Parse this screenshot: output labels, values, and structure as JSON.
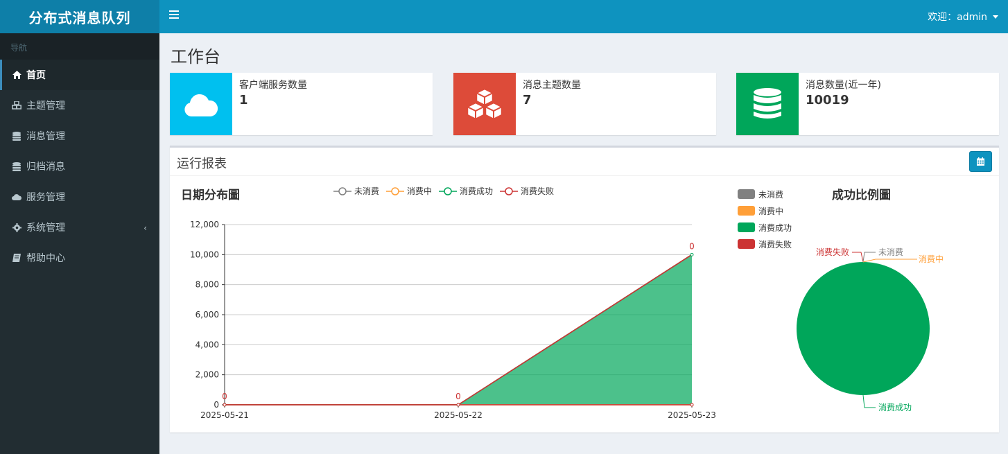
{
  "header": {
    "logo": "分布式消息队列",
    "welcome": "欢迎：admin"
  },
  "sidebar": {
    "header": "导航",
    "items": [
      {
        "label": "首页",
        "icon": "home-icon"
      },
      {
        "label": "主题管理",
        "icon": "cubes-icon"
      },
      {
        "label": "消息管理",
        "icon": "database-icon"
      },
      {
        "label": "归档消息",
        "icon": "database-icon"
      },
      {
        "label": "服务管理",
        "icon": "cloud-icon"
      },
      {
        "label": "系统管理",
        "icon": "gear-icon",
        "arrow": "‹"
      },
      {
        "label": "帮助中心",
        "icon": "book-icon"
      }
    ]
  },
  "page": {
    "title": "工作台"
  },
  "info_boxes": [
    {
      "label": "客户端服务数量",
      "value": "1",
      "color": "#00c0ef",
      "icon": "cloud-icon"
    },
    {
      "label": "消息主题数量",
      "value": "7",
      "color": "#dd4b39",
      "icon": "cubes-icon"
    },
    {
      "label": "消息数量(近一年)",
      "value": "10019",
      "color": "#00a65a",
      "icon": "database-icon"
    }
  ],
  "report": {
    "title": "运行报表",
    "tool_icon": "calendar-icon"
  },
  "chart_data": [
    {
      "type": "area",
      "title": "日期分布圖",
      "x": [
        "2025-05-21",
        "2025-05-22",
        "2025-05-23"
      ],
      "ylim": [
        0,
        12000
      ],
      "yticks": [
        "0",
        "2,000",
        "4,000",
        "6,000",
        "8,000",
        "10,000",
        "12,000"
      ],
      "grid": true,
      "legend_position": "top",
      "series": [
        {
          "name": "未消费",
          "values": [
            0,
            0,
            0
          ],
          "color": "#808080"
        },
        {
          "name": "消费中",
          "values": [
            0,
            0,
            0
          ],
          "color": "#ff9f38"
        },
        {
          "name": "消费成功",
          "values": [
            0,
            0,
            10000
          ],
          "color": "#00a65a"
        },
        {
          "name": "消费失败",
          "values": [
            0,
            0,
            0
          ],
          "color": "#cc3333"
        }
      ],
      "data_labels": [
        "0",
        "0",
        "0"
      ]
    },
    {
      "type": "pie",
      "title": "成功比例圖",
      "legend_position": "left",
      "slices": [
        {
          "name": "未消费",
          "value": 0,
          "color": "#808080"
        },
        {
          "name": "消费中",
          "value": 0,
          "color": "#ff9f38"
        },
        {
          "name": "消费成功",
          "value": 10019,
          "color": "#00a65a"
        },
        {
          "name": "消费失败",
          "value": 0,
          "color": "#cc3333"
        }
      ]
    }
  ]
}
